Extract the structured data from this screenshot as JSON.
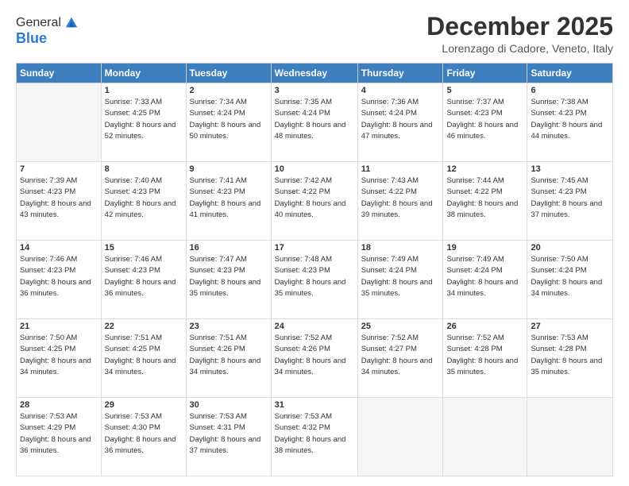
{
  "logo": {
    "general": "General",
    "blue": "Blue"
  },
  "header": {
    "month": "December 2025",
    "location": "Lorenzago di Cadore, Veneto, Italy"
  },
  "weekdays": [
    "Sunday",
    "Monday",
    "Tuesday",
    "Wednesday",
    "Thursday",
    "Friday",
    "Saturday"
  ],
  "weeks": [
    [
      {
        "day": "",
        "empty": true
      },
      {
        "day": "1",
        "sunrise": "7:33 AM",
        "sunset": "4:25 PM",
        "daylight": "8 hours and 52 minutes."
      },
      {
        "day": "2",
        "sunrise": "7:34 AM",
        "sunset": "4:24 PM",
        "daylight": "8 hours and 50 minutes."
      },
      {
        "day": "3",
        "sunrise": "7:35 AM",
        "sunset": "4:24 PM",
        "daylight": "8 hours and 48 minutes."
      },
      {
        "day": "4",
        "sunrise": "7:36 AM",
        "sunset": "4:24 PM",
        "daylight": "8 hours and 47 minutes."
      },
      {
        "day": "5",
        "sunrise": "7:37 AM",
        "sunset": "4:23 PM",
        "daylight": "8 hours and 46 minutes."
      },
      {
        "day": "6",
        "sunrise": "7:38 AM",
        "sunset": "4:23 PM",
        "daylight": "8 hours and 44 minutes."
      }
    ],
    [
      {
        "day": "7",
        "sunrise": "7:39 AM",
        "sunset": "4:23 PM",
        "daylight": "8 hours and 43 minutes."
      },
      {
        "day": "8",
        "sunrise": "7:40 AM",
        "sunset": "4:23 PM",
        "daylight": "8 hours and 42 minutes."
      },
      {
        "day": "9",
        "sunrise": "7:41 AM",
        "sunset": "4:23 PM",
        "daylight": "8 hours and 41 minutes."
      },
      {
        "day": "10",
        "sunrise": "7:42 AM",
        "sunset": "4:22 PM",
        "daylight": "8 hours and 40 minutes."
      },
      {
        "day": "11",
        "sunrise": "7:43 AM",
        "sunset": "4:22 PM",
        "daylight": "8 hours and 39 minutes."
      },
      {
        "day": "12",
        "sunrise": "7:44 AM",
        "sunset": "4:22 PM",
        "daylight": "8 hours and 38 minutes."
      },
      {
        "day": "13",
        "sunrise": "7:45 AM",
        "sunset": "4:23 PM",
        "daylight": "8 hours and 37 minutes."
      }
    ],
    [
      {
        "day": "14",
        "sunrise": "7:46 AM",
        "sunset": "4:23 PM",
        "daylight": "8 hours and 36 minutes."
      },
      {
        "day": "15",
        "sunrise": "7:46 AM",
        "sunset": "4:23 PM",
        "daylight": "8 hours and 36 minutes."
      },
      {
        "day": "16",
        "sunrise": "7:47 AM",
        "sunset": "4:23 PM",
        "daylight": "8 hours and 35 minutes."
      },
      {
        "day": "17",
        "sunrise": "7:48 AM",
        "sunset": "4:23 PM",
        "daylight": "8 hours and 35 minutes."
      },
      {
        "day": "18",
        "sunrise": "7:49 AM",
        "sunset": "4:24 PM",
        "daylight": "8 hours and 35 minutes."
      },
      {
        "day": "19",
        "sunrise": "7:49 AM",
        "sunset": "4:24 PM",
        "daylight": "8 hours and 34 minutes."
      },
      {
        "day": "20",
        "sunrise": "7:50 AM",
        "sunset": "4:24 PM",
        "daylight": "8 hours and 34 minutes."
      }
    ],
    [
      {
        "day": "21",
        "sunrise": "7:50 AM",
        "sunset": "4:25 PM",
        "daylight": "8 hours and 34 minutes."
      },
      {
        "day": "22",
        "sunrise": "7:51 AM",
        "sunset": "4:25 PM",
        "daylight": "8 hours and 34 minutes."
      },
      {
        "day": "23",
        "sunrise": "7:51 AM",
        "sunset": "4:26 PM",
        "daylight": "8 hours and 34 minutes."
      },
      {
        "day": "24",
        "sunrise": "7:52 AM",
        "sunset": "4:26 PM",
        "daylight": "8 hours and 34 minutes."
      },
      {
        "day": "25",
        "sunrise": "7:52 AM",
        "sunset": "4:27 PM",
        "daylight": "8 hours and 34 minutes."
      },
      {
        "day": "26",
        "sunrise": "7:52 AM",
        "sunset": "4:28 PM",
        "daylight": "8 hours and 35 minutes."
      },
      {
        "day": "27",
        "sunrise": "7:53 AM",
        "sunset": "4:28 PM",
        "daylight": "8 hours and 35 minutes."
      }
    ],
    [
      {
        "day": "28",
        "sunrise": "7:53 AM",
        "sunset": "4:29 PM",
        "daylight": "8 hours and 36 minutes."
      },
      {
        "day": "29",
        "sunrise": "7:53 AM",
        "sunset": "4:30 PM",
        "daylight": "8 hours and 36 minutes."
      },
      {
        "day": "30",
        "sunrise": "7:53 AM",
        "sunset": "4:31 PM",
        "daylight": "8 hours and 37 minutes."
      },
      {
        "day": "31",
        "sunrise": "7:53 AM",
        "sunset": "4:32 PM",
        "daylight": "8 hours and 38 minutes."
      },
      {
        "day": "",
        "empty": true
      },
      {
        "day": "",
        "empty": true
      },
      {
        "day": "",
        "empty": true
      }
    ]
  ]
}
